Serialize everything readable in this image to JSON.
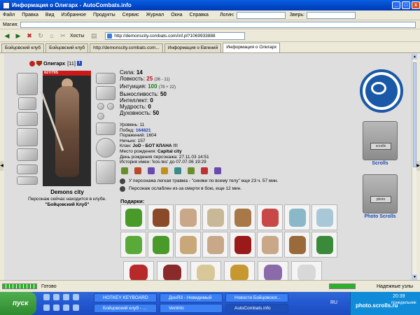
{
  "window": {
    "title": "Информация о Олигарх - AutoCombats.info"
  },
  "menubar": {
    "items": [
      "Файл",
      "Правка",
      "Вид",
      "Избранное",
      "Продукты",
      "Сервис",
      "Журнал",
      "Окна",
      "Справка"
    ],
    "login_label": "Логин:",
    "beast_label": "Зверь:"
  },
  "addrbar1": {
    "label": "Магия:"
  },
  "toolbar": {
    "hosts_label": "Хосты",
    "url": "http://demonscity.combats.com/inf.pl?1069933888"
  },
  "tabs": [
    {
      "label": "Бойцовский клуб"
    },
    {
      "label": "Бойцовский клуб"
    },
    {
      "label": "http://demonscity.combats.com..."
    },
    {
      "label": "Информация о Евгений"
    },
    {
      "label": "Информация о Олигарх"
    }
  ],
  "character": {
    "name": "Олигарх",
    "level": "[11]",
    "hp": "627/705",
    "city": "Demons city",
    "note_line1": "Персонаж сейчас находится в клубе.",
    "note_line2": "\"Бойцовский Клуб\""
  },
  "stats": [
    {
      "label": "Сила:",
      "value": "14",
      "extra": ""
    },
    {
      "label": "Ловкость:",
      "value": "25",
      "extra": "(36 - 11)"
    },
    {
      "label": "Интуиция:",
      "value": "100",
      "extra": "(78 + 22)"
    },
    {
      "label": "Выносливость:",
      "value": "50",
      "extra": ""
    },
    {
      "label": "Интеллект:",
      "value": "0",
      "extra": ""
    },
    {
      "label": "Мудрость:",
      "value": "0",
      "extra": ""
    },
    {
      "label": "Духовность:",
      "value": "50",
      "extra": ""
    }
  ],
  "info": {
    "level_label": "Уровень:",
    "level_value": "11",
    "wins_label": "Побед:",
    "wins_value": "164821",
    "losses_label": "Поражений:",
    "losses_value": "1604",
    "draws_label": "Ничьих:",
    "draws_value": "157",
    "clan_label": "Клан:",
    "clan_value": "JoD - БОТ КЛАНА !!!",
    "birthplace_label": "Место рождения:",
    "birthplace_value": "Capital city",
    "birthday_label": "День рождения персонажа:",
    "birthday_value": "27.11.03 14:51",
    "history_label": "История имен:",
    "history_value": "'kos-tes' до 07.07.06 19:29"
  },
  "badge_colors": [
    "#6a8f2a",
    "#b84a2a",
    "#6a4ab0",
    "#c09020",
    "#3a8a8a",
    "#6a8f2a",
    "#c03030",
    "#6a4ab0"
  ],
  "effects": [
    {
      "text": "У персонажа легкая травма - \"синяки по всему телу\" еще 23 ч. 57 мин."
    },
    {
      "text": "Персонаж ослаблен из-за смерти в бою, еще 12 мин."
    }
  ],
  "gifts_label": "Подарки:",
  "gift_colors_row1": [
    "#4a9a2a",
    "#8a4a2a",
    "#c8a888",
    "#c8b898",
    "#a87848",
    "#c84848",
    "#8ab8c8",
    "#a8c8d8"
  ],
  "gift_colors_row2": [
    "#5aaa3a",
    "#4a9a2a",
    "#c8a878",
    "#c8a888",
    "#9a1a1a",
    "#c8a888",
    "#9a6a3a",
    "#3a8a3a"
  ],
  "gift_colors_row3": [
    "#b82a2a",
    "#8a2a2a",
    "#d8c898",
    "#c89830",
    "#8a6aa8",
    "#d8d8d8"
  ],
  "right_panel": {
    "scrolls_label": "Scrolls",
    "photo_scrolls_label": "Photo Scrolls",
    "scrolls_sign": "scrolls",
    "photo_sign": "photo"
  },
  "statusbar": {
    "ready": "Готово",
    "trusted": "Надежные узлы"
  },
  "taskbar": {
    "start": "пуск",
    "tasks": [
      {
        "label": "HOTKEY KEYBOARD"
      },
      {
        "label": "ДонЯ3 - Невидимый"
      },
      {
        "label": "Новости Бойцовског..."
      },
      {
        "label": "Бойцовский клуб - ..."
      },
      {
        "label": "Ventrilo"
      },
      {
        "label": "AutoCombats.info"
      }
    ],
    "lang": "RU",
    "time": "20:39",
    "day": "понедельник"
  },
  "watermark": "photo.scrolls.ru"
}
